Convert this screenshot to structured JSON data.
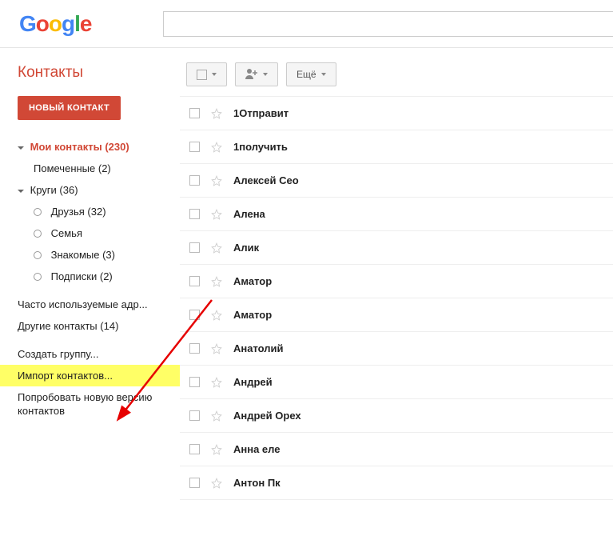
{
  "header": {
    "logo": "Google",
    "search_placeholder": ""
  },
  "sidebar": {
    "app_title": "Контакты",
    "compose_label": "НОВЫЙ КОНТАКТ",
    "my_contacts": {
      "label": "Мои контакты",
      "count": "(230)"
    },
    "starred": {
      "label": "Помеченные",
      "count": "(2)"
    },
    "circles": {
      "label": "Круги",
      "count": "(36)"
    },
    "circle_items": [
      {
        "label": "Друзья",
        "count": "(32)"
      },
      {
        "label": "Семья",
        "count": ""
      },
      {
        "label": "Знакомые",
        "count": "(3)"
      },
      {
        "label": "Подписки",
        "count": "(2)"
      }
    ],
    "frequent": "Часто используемые адр...",
    "other": {
      "label": "Другие контакты",
      "count": "(14)"
    },
    "create_group": "Создать группу...",
    "import": "Импорт контактов...",
    "try_new": "Попробовать новую версию контактов"
  },
  "toolbar": {
    "more_label": "Ещё"
  },
  "contacts": [
    {
      "name": "1Отправит"
    },
    {
      "name": "1получить"
    },
    {
      "name": "Алексей Сео"
    },
    {
      "name": "Алена"
    },
    {
      "name": "Алик"
    },
    {
      "name": "Аматор"
    },
    {
      "name": "Аматор"
    },
    {
      "name": "Анатолий"
    },
    {
      "name": "Андрей"
    },
    {
      "name": "Андрей Орех"
    },
    {
      "name": "Анна еле"
    },
    {
      "name": "Антон Пк"
    }
  ]
}
